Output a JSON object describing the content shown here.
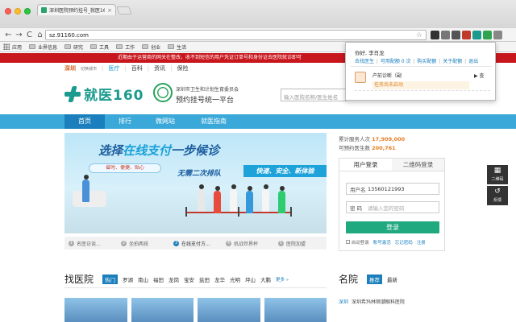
{
  "browser": {
    "tab_title": "深圳医院预约挂号_就医160",
    "url": "sz.91160.com",
    "nav": {
      "back": "←",
      "forward": "→",
      "reload": "C",
      "home": "⌂"
    },
    "bookmarks": [
      "应用",
      "业界信息",
      "研究",
      "工具",
      "工作",
      "创业",
      "生活"
    ]
  },
  "notice": "近期由于运营商的网关在整改，收不到短信的用户凭证订单号和身份证去医院就诊即可",
  "site": {
    "city": "深圳",
    "city_switch": "切换城市",
    "topnav": [
      "医疗",
      "百科",
      "资讯",
      "保险"
    ],
    "logo": "就医160",
    "gov_line1": "深圳市卫生和计划生育委员会",
    "gov_line2": "预约挂号统一平台",
    "search_placeholder": "输入医院名称/医生姓名",
    "mainnav": [
      "首页",
      "排行",
      "微网站",
      "就医指南"
    ]
  },
  "banner": {
    "headline_a": "选择",
    "headline_hl": "在线支付",
    "headline_b": "一步候诊",
    "ribbon": "省时、便捷、贴心",
    "sub1": "无需二次排队",
    "sub2": "快速、安全、新体验",
    "steps": [
      {
        "num": "1",
        "label": "名医访谈..."
      },
      {
        "num": "2",
        "label": "坐拍两孩"
      },
      {
        "num": "3",
        "label": "在线支付方..."
      },
      {
        "num": "4",
        "label": "机战世界杯"
      },
      {
        "num": "5",
        "label": "医院加盟"
      }
    ]
  },
  "stats": {
    "served_label": "累计服务人次",
    "served_value": "17,909,000",
    "doctors_label": "可预约医生数",
    "doctors_value": "200,761"
  },
  "login": {
    "tab_user": "用户登录",
    "tab_qr": "二维码登录",
    "account_label": "用户名",
    "account_value": "13560121993",
    "password_label": "密 码",
    "password_placeholder": "请输入您的密码",
    "submit": "登录",
    "remember": "自动登录",
    "links": [
      "账号激活",
      "忘记密码",
      "注册"
    ]
  },
  "side_tools": [
    {
      "icon": "▦",
      "label": "二维码"
    },
    {
      "icon": "↺",
      "label": "反馈"
    }
  ],
  "find_hospital": {
    "title": "找医院",
    "hot": "热门",
    "areas": [
      "罗湖",
      "南山",
      "福田",
      "龙岗",
      "宝安",
      "盐田",
      "龙华",
      "光明",
      "坪山",
      "大鹏"
    ],
    "more": "更多 »"
  },
  "famous": {
    "title": "名院",
    "tabs": [
      "推荐",
      "最新"
    ],
    "city": "深圳",
    "hospital": "深圳希玛林顺潮眼科医院"
  },
  "popup": {
    "greeting": "你好, 李肖龙",
    "links": [
      "去找医生",
      "可用配额 0 次",
      "购买配额",
      "关于配额",
      "退出"
    ],
    "item_name": "产前诊断（副",
    "item_action": "▶ 查",
    "item_status": "任务尚未启动"
  },
  "colors": {
    "brand": "#1a9b8e",
    "nav_blue": "#3aa8d8",
    "notice_red": "#c8161d",
    "login_green": "#20a87e"
  }
}
